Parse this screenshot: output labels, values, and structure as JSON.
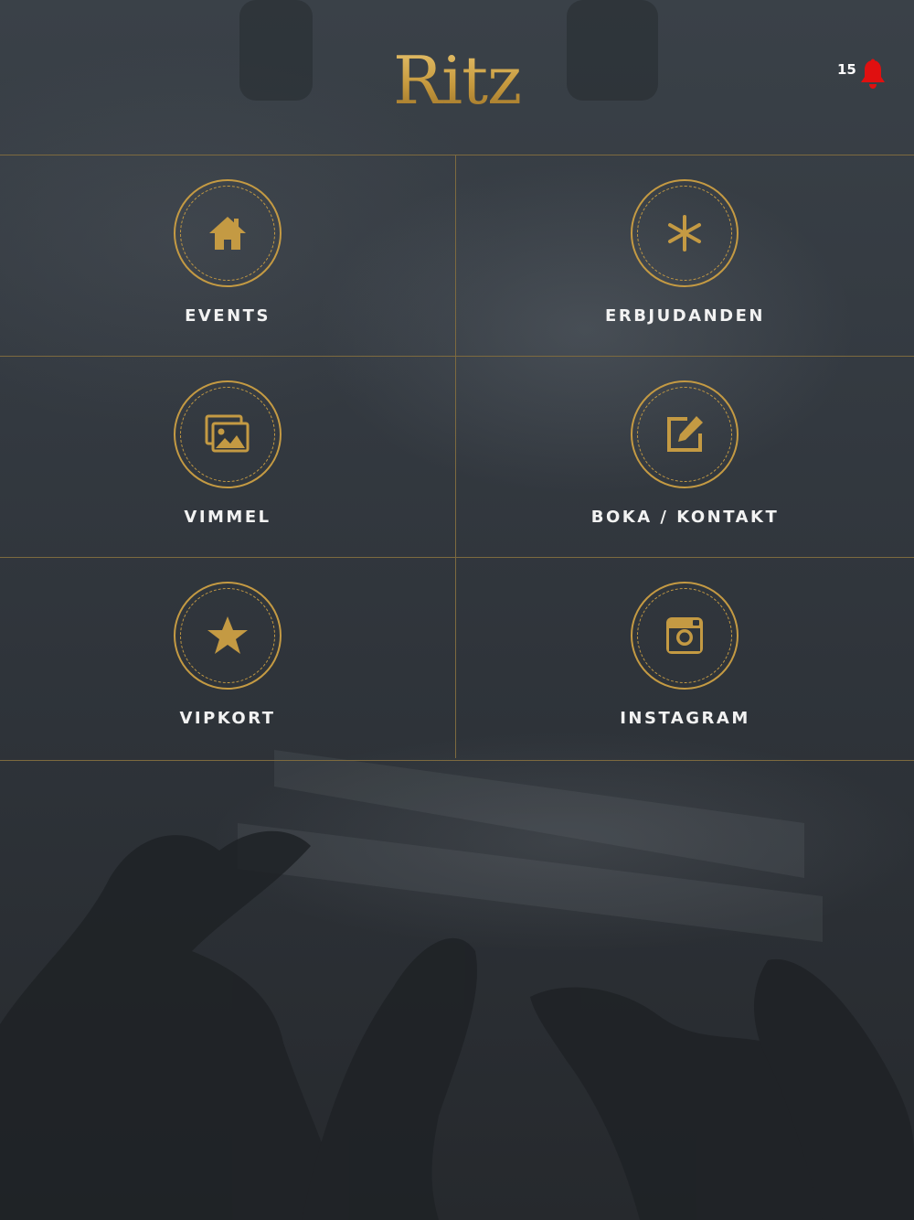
{
  "header": {
    "logo_text": "Ritz",
    "notification_count": "15"
  },
  "colors": {
    "gold": "#c49a43",
    "divider": "#7d6a3f",
    "bell": "#e01010",
    "label": "#f2f2f2"
  },
  "menu": [
    {
      "label": "EVENTS",
      "icon": "home-icon"
    },
    {
      "label": "ERBJUDANDEN",
      "icon": "asterisk-icon"
    },
    {
      "label": "VIMMEL",
      "icon": "photos-icon"
    },
    {
      "label": "BOKA / KONTAKT",
      "icon": "edit-icon"
    },
    {
      "label": "VIPKORT",
      "icon": "star-icon"
    },
    {
      "label": "INSTAGRAM",
      "icon": "instagram-icon"
    }
  ]
}
